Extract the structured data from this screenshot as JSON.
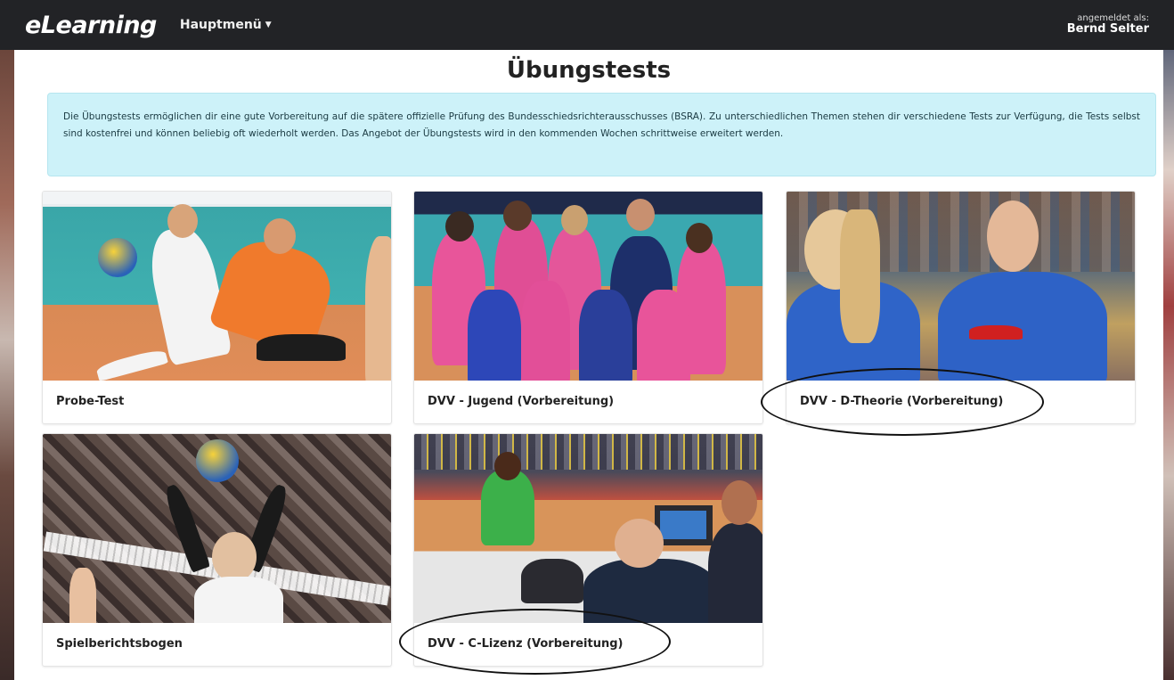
{
  "navbar": {
    "brand": "eLearning",
    "menu_label": "Hauptmenü",
    "user_label": "angemeldet als:",
    "user_name": "Bernd Selter"
  },
  "page": {
    "title": "Übungstests",
    "info_text": "Die Übungstests ermöglichen dir eine gute Vorbereitung auf die spätere offizielle Prüfung des Bundesschiedsrichterausschusses (BSRA). Zu unterschiedlichen Themen stehen dir verschiedene Tests zur Verfügung, die Tests selbst sind kostenfrei und können beliebig oft wiederholt werden. Das Angebot der Übungstests wird in den kommenden Wochen schrittweise erweitert werden."
  },
  "cards": [
    {
      "label": "Probe-Test",
      "image": "volleyball-dig-photo"
    },
    {
      "label": "DVV - Jugend (Vorbereitung)",
      "image": "team-huddle-photo"
    },
    {
      "label": "DVV - D-Theorie (Vorbereitung)",
      "image": "players-blue-jerseys-photo",
      "circled": true
    },
    {
      "label": "Spielberichtsbogen",
      "image": "volleyball-set-photo"
    },
    {
      "label": "DVV - C-Lizenz (Vorbereitung)",
      "image": "scorer-table-photo",
      "circled": true
    }
  ],
  "colors": {
    "navbar": "#222326",
    "info_bg": "#cdf2f9",
    "annotation": "#111111"
  }
}
